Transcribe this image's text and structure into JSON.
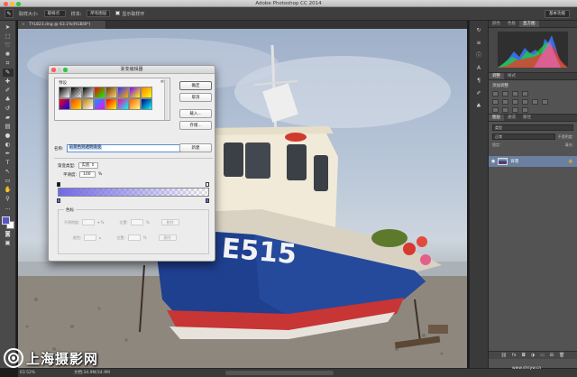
{
  "app": {
    "title": "Adobe Photoshop CC 2014"
  },
  "options_bar": {
    "sample_size_label": "取样大小:",
    "sample_size_value": "取样点",
    "sample_label": "样本:",
    "sample_value": "所有图层",
    "show_ring_label": "显示取样环",
    "workspace": "基本功能"
  },
  "document": {
    "tab_title": "TYL823.dng @ 63.1%(RGB/8*)"
  },
  "boat": {
    "hull_number": "E515"
  },
  "gradient_editor": {
    "title": "渐变编辑器",
    "presets_label": "预设",
    "ok": "确定",
    "cancel": "取消",
    "load": "载入...",
    "save": "存储...",
    "name_label": "名称:",
    "name_value": "前景色到透明渐变",
    "new": "新建",
    "type_label": "渐变类型:",
    "type_value": "实底",
    "smoothness_label": "平滑度:",
    "smoothness_value": "100",
    "smoothness_unit": "%",
    "stops_legend": "色标",
    "opacity_label": "不透明度:",
    "color_label": "颜色:",
    "location_label": "位置:",
    "location_unit": "%",
    "delete": "删除",
    "swatches": [
      [
        "#000000",
        "#ffffff"
      ],
      [
        "#000000",
        "#00000000"
      ],
      [
        "#000000",
        "#ffffff"
      ],
      [
        "#ff0000",
        "#00ff00"
      ],
      [
        "#6b3b00",
        "#ffd27a"
      ],
      [
        "#3030ff",
        "#ffb000"
      ],
      [
        "#8000ff",
        "#ffff00"
      ],
      [
        "#ff8000",
        "#ffff00"
      ],
      [
        "#ff0000",
        "#0000ff"
      ],
      [
        "#ff4000",
        "#ffe000"
      ],
      [
        "#c08000",
        "#ffffff"
      ],
      [
        "#00a0ff",
        "#ff00ff"
      ],
      [
        "#ff0000",
        "#ffff00"
      ],
      [
        "#ff00a0",
        "#00ffff"
      ],
      [
        "#ff6000",
        "#ffff80"
      ],
      [
        "#000080",
        "#00ffff"
      ]
    ],
    "stop_color": "#6f69e6"
  },
  "right_panels": {
    "top_tabs": [
      "颜色",
      "色板",
      "直方图"
    ],
    "adjust_tabs": [
      "调整",
      "样式"
    ],
    "adjust_title": "添加调整",
    "layer_tabs": [
      "图层",
      "通道",
      "路径"
    ],
    "kind_label": "类型",
    "mode_label": "正常",
    "opacity_label": "不透明度:",
    "lock_label": "锁定:",
    "fill_label": "填充:",
    "layer_name": "背景"
  },
  "status": {
    "zoom": "63.52%",
    "doc": "文档:34.9M/34.9M"
  },
  "watermark": {
    "text": "上海摄影网",
    "url": "www.shsyw.cn"
  },
  "colors": {
    "foreground": "#5a55c4",
    "background": "#ffffff",
    "hull": "#1f3f8f",
    "accent_ui": "#5b8fd8"
  }
}
